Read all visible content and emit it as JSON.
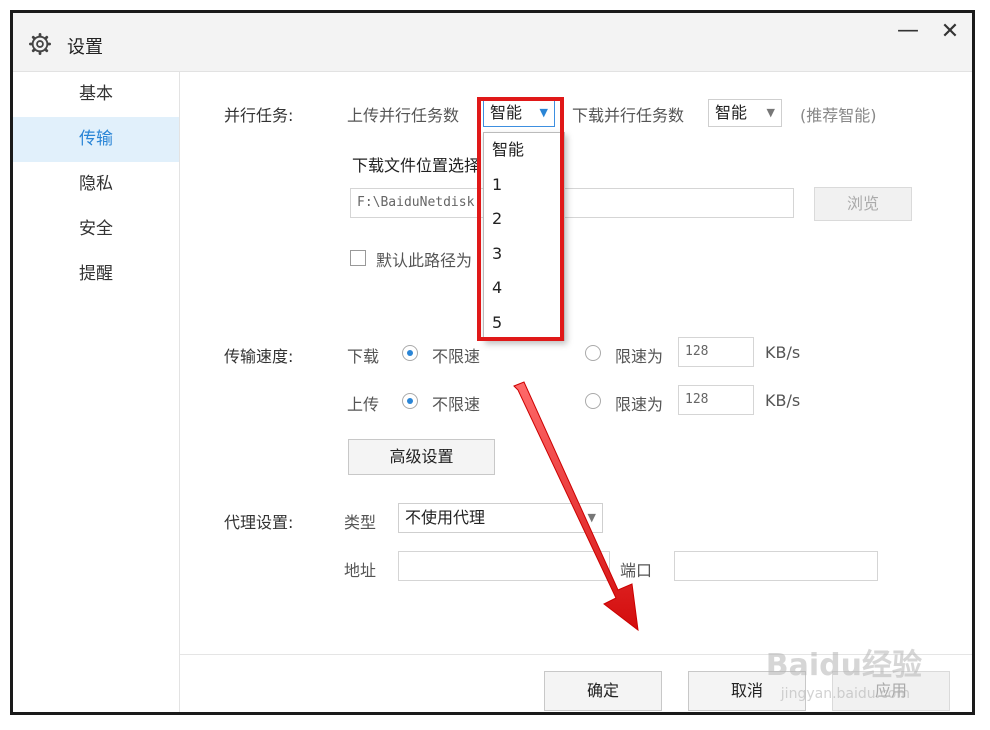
{
  "window": {
    "title": "设置",
    "minimize": "—",
    "close": "✕"
  },
  "sidebar": {
    "items": [
      {
        "label": "基本"
      },
      {
        "label": "传输"
      },
      {
        "label": "隐私"
      },
      {
        "label": "安全"
      },
      {
        "label": "提醒"
      }
    ],
    "active": "传输"
  },
  "parallel": {
    "section_label": "并行任务:",
    "upload_label": "上传并行任务数",
    "upload_value": "智能",
    "download_label": "下载并行任务数",
    "download_value": "智能",
    "hint": "(推荐智能)",
    "dropdown_options": [
      "智能",
      "1",
      "2",
      "3",
      "4",
      "5"
    ]
  },
  "download_location": {
    "label": "下载文件位置选择",
    "path": "F:\\BaiduNetdisk",
    "browse_label": "浏览",
    "default_checkbox_label": "默认此路径为"
  },
  "speed": {
    "section_label": "传输速度:",
    "download_label": "下载",
    "upload_label": "上传",
    "unlimited_label": "不限速",
    "limit_label": "限速为",
    "download_limit_value": "128",
    "upload_limit_value": "128",
    "unit": "KB/s",
    "advanced_label": "高级设置"
  },
  "proxy": {
    "section_label": "代理设置:",
    "type_label": "类型",
    "type_value": "不使用代理",
    "address_label": "地址",
    "port_label": "端口"
  },
  "footer": {
    "ok_label": "确定",
    "cancel_label": "取消",
    "apply_label": "应用"
  },
  "watermark": {
    "brand": "Baidu经验",
    "url": "jingyan.baidu.com"
  },
  "colors": {
    "accent": "#2a85d6",
    "highlight": "#e01818",
    "arrow": "#e02020"
  }
}
